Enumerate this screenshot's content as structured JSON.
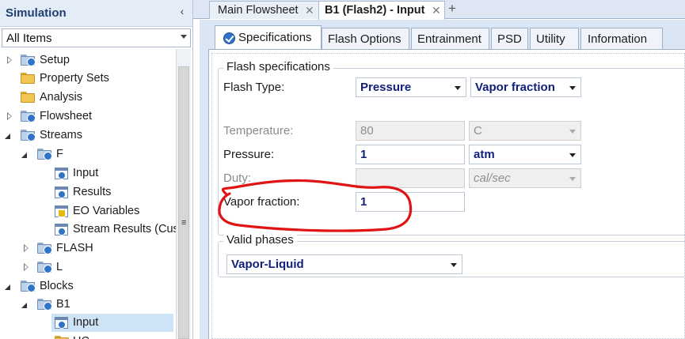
{
  "nav": {
    "title": "Simulation",
    "filter": "All Items",
    "tree": [
      {
        "label": "Setup"
      },
      {
        "label": "Property Sets"
      },
      {
        "label": "Analysis"
      },
      {
        "label": "Flowsheet"
      },
      {
        "label": "Streams"
      },
      {
        "label": "F"
      },
      {
        "label": "Input"
      },
      {
        "label": "Results"
      },
      {
        "label": "EO Variables"
      },
      {
        "label": "Stream Results (Cus"
      },
      {
        "label": "FLASH"
      },
      {
        "label": "L"
      },
      {
        "label": "Blocks"
      },
      {
        "label": "B1"
      },
      {
        "label": "Input"
      },
      {
        "label": "HC"
      }
    ]
  },
  "doc_tabs": [
    {
      "label": "Main Flowsheet",
      "close": "✕"
    },
    {
      "label": "B1 (Flash2) - Input",
      "close": "✕"
    }
  ],
  "new_tab": "+",
  "sub_tabs": [
    {
      "label": "Specifications"
    },
    {
      "label": "Flash Options"
    },
    {
      "label": "Entrainment"
    },
    {
      "label": "PSD"
    },
    {
      "label": "Utility"
    },
    {
      "label": "Information"
    }
  ],
  "flash_specs": {
    "title": "Flash specifications",
    "flash_type_label": "Flash Type:",
    "flash_type_1": "Pressure",
    "flash_type_2": "Vapor fraction",
    "temperature_label": "Temperature:",
    "temperature_value": "80",
    "temperature_unit": "C",
    "pressure_label": "Pressure:",
    "pressure_value": "1",
    "pressure_unit": "atm",
    "duty_label": "Duty:",
    "duty_value": "",
    "duty_unit": "cal/sec",
    "vapor_fraction_label": "Vapor fraction:",
    "vapor_fraction_value": "1"
  },
  "valid_phases": {
    "title": "Valid phases",
    "value": "Vapor-Liquid"
  },
  "colors": {
    "annotation": "#e01414",
    "value_text": "#0f1f7a",
    "nav_title": "#1f3f6e"
  }
}
